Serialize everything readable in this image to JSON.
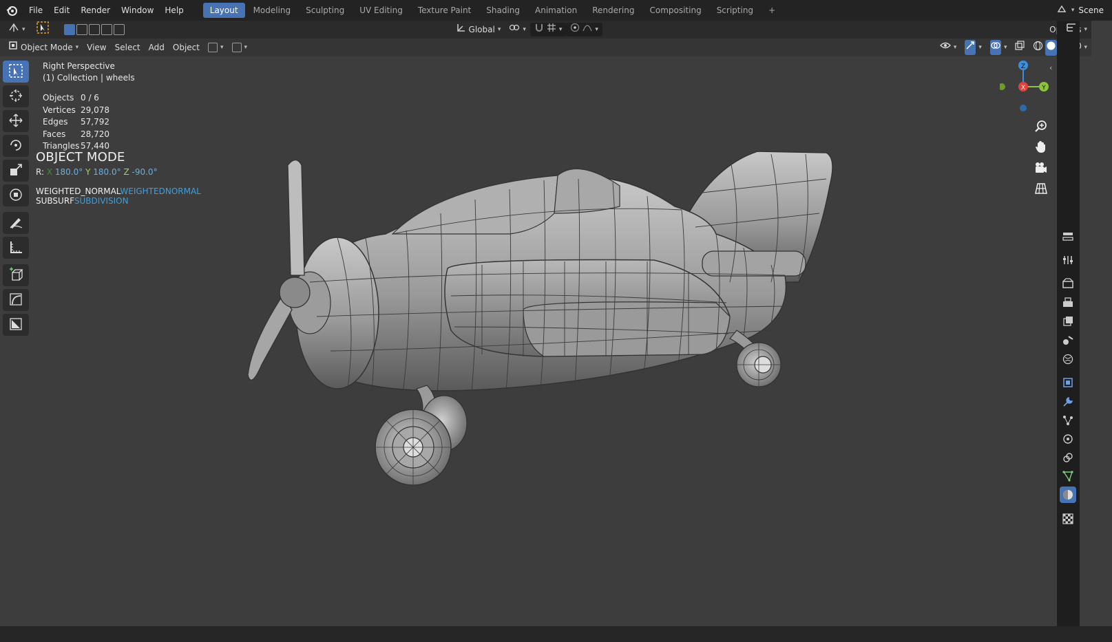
{
  "menu": [
    "File",
    "Edit",
    "Render",
    "Window",
    "Help"
  ],
  "workspaces": [
    "Layout",
    "Modeling",
    "Sculpting",
    "UV Editing",
    "Texture Paint",
    "Shading",
    "Animation",
    "Rendering",
    "Compositing",
    "Scripting"
  ],
  "active_workspace": "Layout",
  "add_workspace": "+",
  "scene_name": "Scene",
  "toolbar": {
    "orientation": "Global",
    "options": "Options"
  },
  "viewport_header": {
    "mode": "Object Mode",
    "view": "View",
    "select": "Select",
    "add": "Add",
    "object": "Object"
  },
  "overlay": {
    "view_name": "Right Perspective",
    "collection": "(1) Collection | wheels"
  },
  "stats": [
    {
      "label": "Objects",
      "value": "0 / 6"
    },
    {
      "label": "Vertices",
      "value": "29,078"
    },
    {
      "label": "Edges",
      "value": "57,792"
    },
    {
      "label": "Faces",
      "value": "28,720"
    },
    {
      "label": "Triangles",
      "value": "57,440"
    }
  ],
  "mode_text": "OBJECT MODE",
  "rotation": {
    "prefix": "R:",
    "x_label": "X",
    "x": "180.0°",
    "y_label": "Y",
    "y": "180.0°",
    "z_label": "Z",
    "z": "-90.0°"
  },
  "modifiers": [
    {
      "name": "WEIGHTED_NORMAL",
      "type": "WEIGHTEDNORMAL"
    },
    {
      "name": "SUBSURF",
      "type": "SUBDIVISION"
    }
  ],
  "gizmo": {
    "z": "Z",
    "x": "X",
    "y": "Y"
  },
  "colors": {
    "accent": "#4772b3",
    "axis_x": "#e0423c",
    "axis_y": "#8cc43b",
    "axis_z": "#3b8ee0",
    "modifier_blue": "#3d9fe0"
  },
  "icons": {
    "tools": [
      "select-box-icon",
      "cursor-icon",
      "move-icon",
      "rotate-icon",
      "scale-icon",
      "transform-icon",
      "annotate-icon",
      "measure-icon",
      "add-cube-icon",
      "curve-icon",
      "shade-icon"
    ],
    "nav": [
      "zoom-icon",
      "pan-hand-icon",
      "camera-icon",
      "grid-perspective-icon"
    ],
    "properties": [
      "tool-icon",
      "render-icon",
      "output-icon",
      "view-layer-icon",
      "scene-icon",
      "world-icon",
      "object-icon",
      "modifier-icon",
      "particles-icon",
      "physics-icon",
      "constraints-icon",
      "data-icon",
      "material-icon",
      "texture-icon"
    ]
  }
}
